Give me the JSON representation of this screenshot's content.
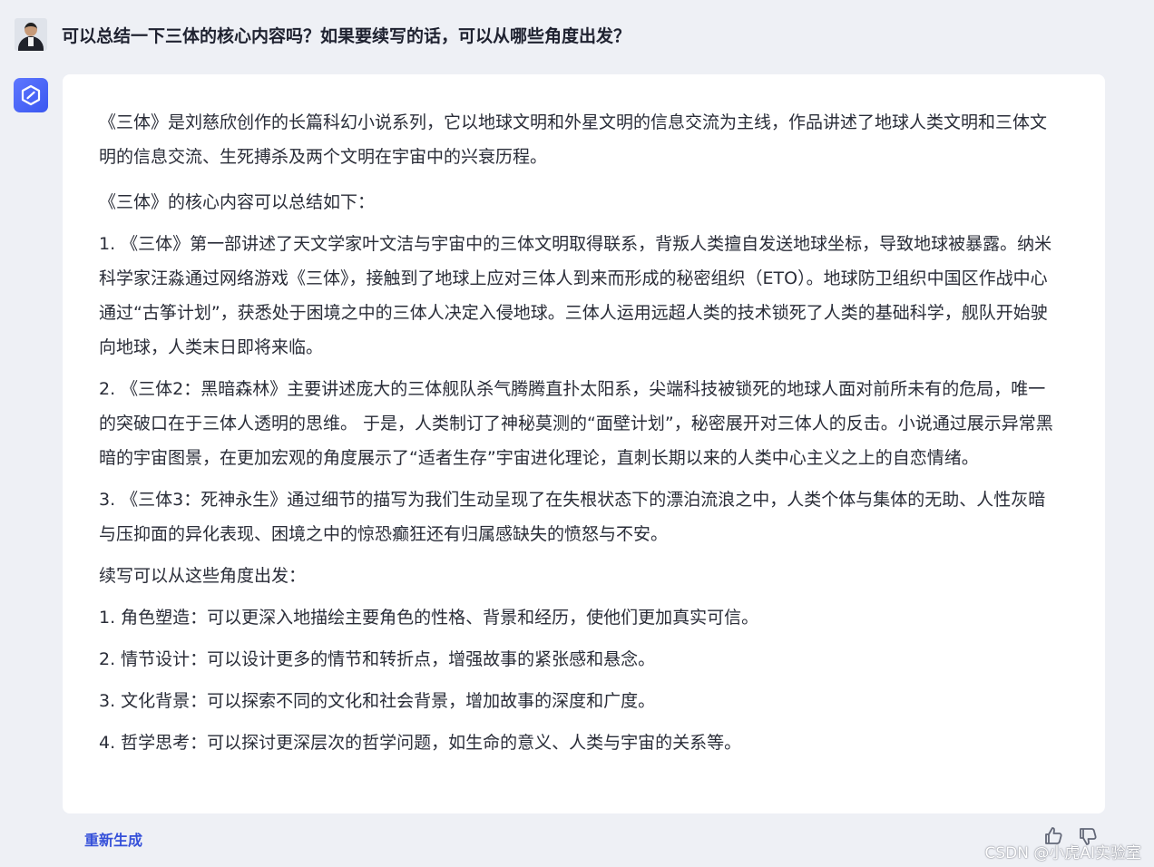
{
  "user": {
    "question": "可以总结一下三体的核心内容吗？如果要续写的话，可以从哪些角度出发？"
  },
  "answer": {
    "intro": "《三体》是刘慈欣创作的长篇科幻小说系列，它以地球文明和外星文明的信息交流为主线，作品讲述了地球人类文明和三体文明的信息交流、生死搏杀及两个文明在宇宙中的兴衰历程。",
    "summary_heading": "《三体》的核心内容可以总结如下：",
    "summary_items": [
      "1. 《三体》第一部讲述了天文学家叶文洁与宇宙中的三体文明取得联系，背叛人类擅自发送地球坐标，导致地球被暴露。纳米科学家汪淼通过网络游戏《三体》，接触到了地球上应对三体人到来而形成的秘密组织（ETO）。地球防卫组织中国区作战中心通过“古筝计划”，获悉处于困境之中的三体人决定入侵地球。三体人运用远超人类的技术锁死了人类的基础科学，舰队开始驶向地球，人类末日即将来临。",
      "2. 《三体2：黑暗森林》主要讲述庞大的三体舰队杀气腾腾直扑太阳系，尖端科技被锁死的地球人面对前所未有的危局，唯一的突破口在于三体人透明的思维。 于是，人类制订了神秘莫测的“面壁计划”，秘密展开对三体人的反击。小说通过展示异常黑暗的宇宙图景，在更加宏观的角度展示了“适者生存”宇宙进化理论，直刺长期以来的人类中心主义之上的自恋情绪。",
      "3. 《三体3：死神永生》通过细节的描写为我们生动呈现了在失根状态下的漂泊流浪之中，人类个体与集体的无助、人性灰暗与压抑面的异化表现、困境之中的惊恐癫狂还有归属感缺失的愤怒与不安。"
    ],
    "continuation_heading": "续写可以从这些角度出发：",
    "continuation_items": [
      "1. 角色塑造：可以更深入地描绘主要角色的性格、背景和经历，使他们更加真实可信。",
      "2. 情节设计：可以设计更多的情节和转折点，增强故事的紧张感和悬念。",
      "3. 文化背景：可以探索不同的文化和社会背景，增加故事的深度和广度。",
      "4. 哲学思考：可以探讨更深层次的哲学问题，如生命的意义、人类与宇宙的关系等。"
    ]
  },
  "footer": {
    "regenerate_label": "重新生成",
    "watermark": "CSDN @小虎AI实验室"
  },
  "icons": {
    "user_avatar": "user-avatar",
    "bot_logo": "bot-logo-icon",
    "like": "thumbs-up-icon",
    "dislike": "thumbs-down-icon"
  },
  "colors": {
    "page_background": "#eef0f5",
    "card_background": "#ffffff",
    "accent": "#3550d9",
    "logo": "#4a63f5",
    "text": "#2a2d38"
  }
}
